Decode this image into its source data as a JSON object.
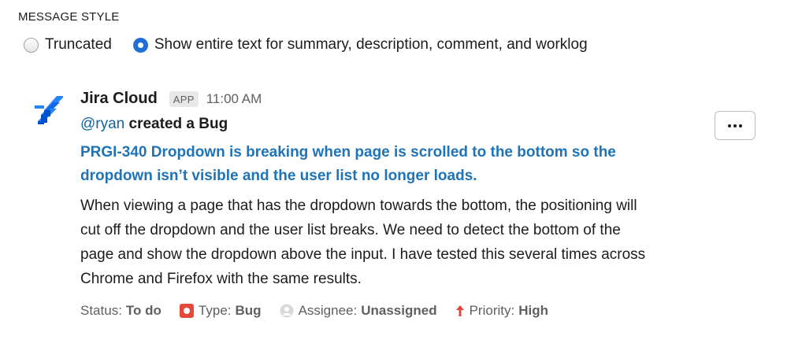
{
  "section": {
    "label": "MESSAGE STYLE"
  },
  "message_style": {
    "options": [
      {
        "label": "Truncated",
        "selected": false
      },
      {
        "label": "Show entire text for summary, description, comment, and worklog",
        "selected": true
      }
    ]
  },
  "message": {
    "app_name": "Jira Cloud",
    "badge": "APP",
    "time": "11:00 AM",
    "mention": "@ryan",
    "action": "created a Bug",
    "issue_title": "PRGI-340 Dropdown is breaking when page is scrolled to the bottom so the dropdown isn’t visible and the user list no longer loads.",
    "description": "When viewing a page that has the dropdown towards the bottom, the positioning will cut off the dropdown and the user list breaks. We need to detect the bottom of the page and show the dropdown above the input. I have tested this several times across Chrome and Firefox with the same results.",
    "meta": {
      "status_label": "Status:",
      "status_value": "To do",
      "type_label": "Type:",
      "type_value": "Bug",
      "assignee_label": "Assignee:",
      "assignee_value": "Unassigned",
      "priority_label": "Priority:",
      "priority_value": "High"
    }
  },
  "icons": {
    "logo": "jira-logo",
    "bug": "bug-icon",
    "assignee": "user-icon",
    "priority": "arrow-up-icon",
    "more": "more-horizontal-icon"
  },
  "colors": {
    "link": "#1f73b7",
    "radio_selected": "#1f6fd6",
    "bug": "#e5493a",
    "priority_high": "#e5493a",
    "jira_blue": "#2684ff"
  }
}
